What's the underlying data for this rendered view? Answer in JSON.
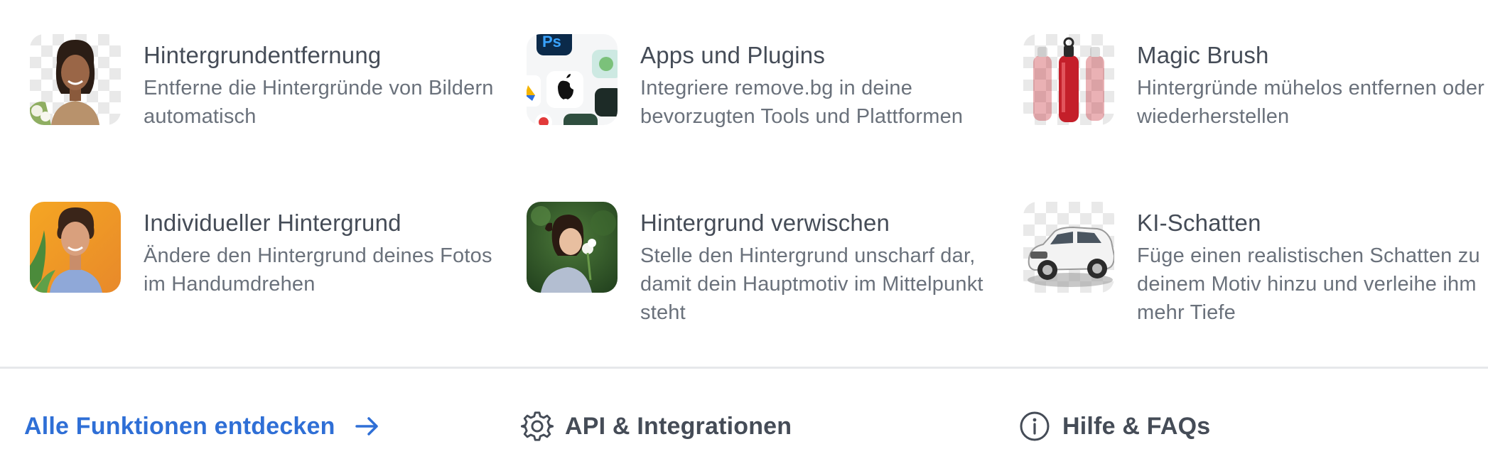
{
  "features": [
    {
      "title": "Hintergrundentfernung",
      "desc": "Entferne die Hintergründe von Bildern automatisch",
      "icon": "portrait-woman-thumbnail"
    },
    {
      "title": "Apps und Plugins",
      "desc": "Integriere remove.bg in deine bevorzugten Tools und Plattformen",
      "icon": "app-icons-thumbnail"
    },
    {
      "title": "Magic Brush",
      "desc": "Hintergründe mühelos entfernen oder wiederherstellen",
      "icon": "bottles-thumbnail"
    },
    {
      "title": "Individueller Hintergrund",
      "desc": "Ändere den Hintergrund deines Fotos im Handumdrehen",
      "icon": "portrait-man-thumbnail"
    },
    {
      "title": "Hintergrund verwischen",
      "desc": "Stelle den Hintergrund unscharf dar, damit dein Hauptmotiv im Mittelpunkt steht",
      "icon": "girl-flower-thumbnail"
    },
    {
      "title": "KI-Schatten",
      "desc": "Füge einen realistischen Schatten zu deinem Motiv hinzu und verleihe ihm mehr Tiefe",
      "icon": "car-thumbnail"
    }
  ],
  "footer": {
    "all_features": "Alle Funktionen entdecken",
    "api": "API & Integrationen",
    "help": "Hilfe & FAQs"
  },
  "colors": {
    "link_blue": "#2f6fd6",
    "title_text": "#454c57",
    "body_text": "#6a717b",
    "divider": "#e6e8eb"
  }
}
